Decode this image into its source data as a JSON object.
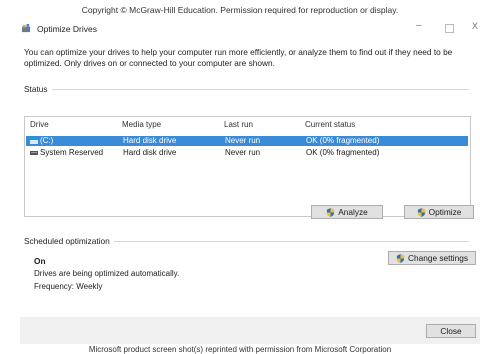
{
  "copyright": "Copyright © McGraw-Hill Education. Permission required for reproduction or display.",
  "window": {
    "title": "Optimize Drives",
    "icon": "optimize-drives-icon",
    "controls": {
      "minimize": "–",
      "close": "X"
    }
  },
  "description": "You can optimize your drives to help your computer run more efficiently, or analyze them to find out if they need to be optimized. Only drives on or connected to your computer are shown.",
  "status_section": {
    "label": "Status",
    "columns": [
      "Drive",
      "Media type",
      "Last run",
      "Current status"
    ],
    "rows": [
      {
        "drive": "(C:)",
        "media_type": "Hard disk drive",
        "last_run": "Never run",
        "current_status": "OK (0% fragmented)",
        "selected": true
      },
      {
        "drive": "System Reserved",
        "media_type": "Hard disk drive",
        "last_run": "Never run",
        "current_status": "OK (0% fragmented)",
        "selected": false
      }
    ],
    "analyze_label": "Analyze",
    "optimize_label": "Optimize"
  },
  "scheduled": {
    "label": "Scheduled optimization",
    "state": "On",
    "detail": "Drives are being optimized automatically.",
    "frequency": "Frequency: Weekly",
    "change_settings_label": "Change settings"
  },
  "close_label": "Close",
  "footnote": "Microsoft product screen shot(s) reprinted with permission from Microsoft Corporation",
  "colors": {
    "selection": "#3a8ad6",
    "button": "#e1e1e1",
    "footer": "#f0f0f0"
  }
}
